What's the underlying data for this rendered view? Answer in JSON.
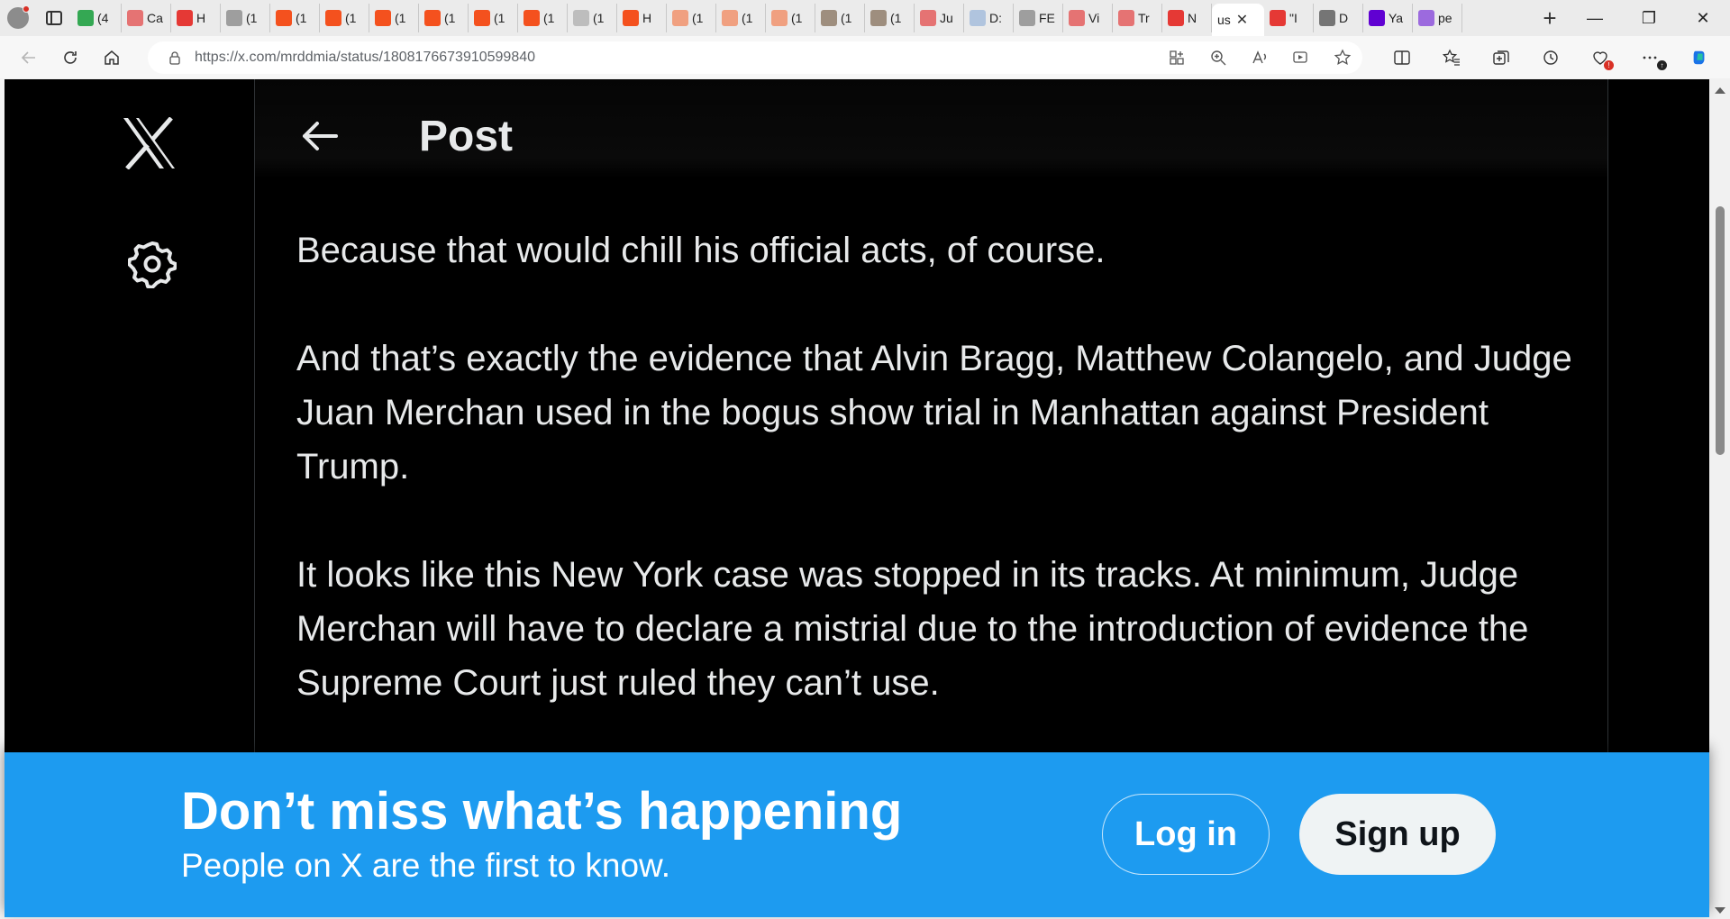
{
  "browser": {
    "tabs": [
      {
        "favicon": "green-g-icon",
        "color": "#34a853",
        "label": "(4"
      },
      {
        "favicon": "youtube-icon",
        "color": "#e57373",
        "label": "Ca"
      },
      {
        "favicon": "arrow-up-icon",
        "color": "#e53935",
        "label": "H"
      },
      {
        "favicon": "page-icon",
        "color": "#9e9e9e",
        "label": "(1"
      },
      {
        "favicon": "bookmark-icon",
        "color": "#f4511e",
        "label": "(1"
      },
      {
        "favicon": "bookmark-icon",
        "color": "#f4511e",
        "label": "(1"
      },
      {
        "favicon": "bookmark-icon",
        "color": "#f4511e",
        "label": "(1"
      },
      {
        "favicon": "bookmark-icon",
        "color": "#f4511e",
        "label": "(1"
      },
      {
        "favicon": "bookmark-icon",
        "color": "#f4511e",
        "label": "(1"
      },
      {
        "favicon": "bookmark-icon",
        "color": "#f4511e",
        "label": "(1"
      },
      {
        "favicon": "image-icon",
        "color": "#bdbdbd",
        "label": "(1"
      },
      {
        "favicon": "bookmark-icon",
        "color": "#f4511e",
        "label": "H"
      },
      {
        "favicon": "bookmark-icon",
        "color": "#f0a080",
        "label": "(1"
      },
      {
        "favicon": "bookmark-icon",
        "color": "#f0a080",
        "label": "(1"
      },
      {
        "favicon": "bookmark-icon",
        "color": "#f0a080",
        "label": "(1"
      },
      {
        "favicon": "photo-icon",
        "color": "#9e8e7e",
        "label": "(1"
      },
      {
        "favicon": "photo-icon",
        "color": "#9e8e7e",
        "label": "(1"
      },
      {
        "favicon": "youtube-icon",
        "color": "#e57373",
        "label": "Ju"
      },
      {
        "favicon": "globe-icon",
        "color": "#b0c4de",
        "label": "D:"
      },
      {
        "favicon": "page-icon",
        "color": "#9e9e9e",
        "label": "FE"
      },
      {
        "favicon": "star-icon",
        "color": "#e57373",
        "label": "Vi"
      },
      {
        "favicon": "youtube-icon",
        "color": "#e57373",
        "label": "Tr"
      },
      {
        "favicon": "r-icon",
        "color": "#e53935",
        "label": "N"
      }
    ],
    "active_tab": {
      "label": "us"
    },
    "tabs_after": [
      {
        "favicon": "youtube-icon",
        "color": "#e53935",
        "label": "\"I"
      },
      {
        "favicon": "nn-icon",
        "color": "#757575",
        "label": "D"
      },
      {
        "favicon": "yahoo-icon",
        "color": "#6001d2",
        "label": "Ya"
      },
      {
        "favicon": "yahoo-icon",
        "color": "#9c6ade",
        "label": "pe"
      }
    ],
    "url": "https://x.com/mrddmia/status/1808176673910599840"
  },
  "page": {
    "header_title": "Post",
    "tweet_paragraphs": [
      "Because that would chill his official acts, of course.",
      "And that’s exactly the evidence that Alvin Bragg, Matthew Colangelo, and Judge Juan Merchan used in the bogus show trial in Manhattan against President Trump.",
      "It looks like this New York case was stopped in its tracks. At minimum, Judge Merchan will have to declare a mistrial due to the introduction of evidence the Supreme Court just ruled they can’t use."
    ]
  },
  "banner": {
    "title": "Don’t miss what’s happening",
    "subtitle": "People on X are the first to know.",
    "login_label": "Log in",
    "signup_label": "Sign up",
    "color": "#1d9bf0"
  }
}
